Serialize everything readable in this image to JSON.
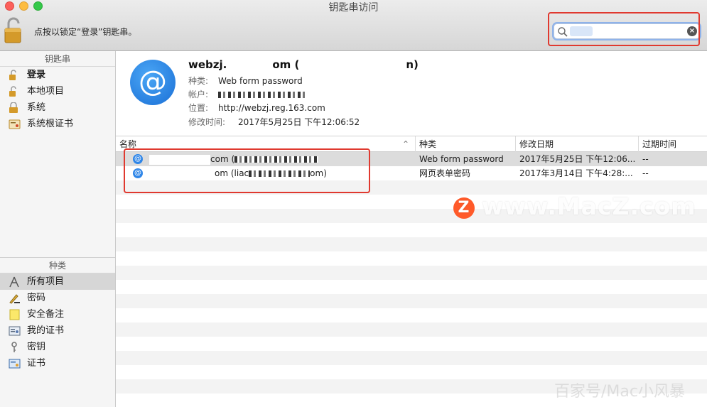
{
  "window": {
    "title": "钥匙串访问"
  },
  "toolbar": {
    "lock_hint": "点按以锁定“登录”钥匙串。"
  },
  "search": {
    "value": "",
    "placeholder": ""
  },
  "sidebar": {
    "keychains_header": "钥匙串",
    "keychains": [
      {
        "label": "登录",
        "icon": "lock-open-icon"
      },
      {
        "label": "本地项目",
        "icon": "lock-open-icon"
      },
      {
        "label": "系统",
        "icon": "lock-icon"
      },
      {
        "label": "系统根证书",
        "icon": "certificate-icon"
      }
    ],
    "kinds_header": "种类",
    "kinds": [
      {
        "label": "所有项目",
        "icon": "all-items-icon"
      },
      {
        "label": "密码",
        "icon": "password-icon"
      },
      {
        "label": "安全备注",
        "icon": "secure-note-icon"
      },
      {
        "label": "我的证书",
        "icon": "my-cert-icon"
      },
      {
        "label": "密钥",
        "icon": "key-icon"
      },
      {
        "label": "证书",
        "icon": "certificate-icon"
      }
    ]
  },
  "detail": {
    "title_prefix": "webzj.",
    "title_mid": "om (",
    "title_suffix": "n)",
    "kind_label": "种类:",
    "kind_value": "Web form password",
    "account_label": "帐户:",
    "where_label": "位置:",
    "where_value": "http://webzj.reg.163.com",
    "modified_label": "修改时间:",
    "modified_value": "2017年5月25日 下午12:06:52"
  },
  "table": {
    "columns": [
      "名称",
      "种类",
      "修改日期",
      "过期时间"
    ],
    "rows": [
      {
        "name_suffix": "com (",
        "kind": "Web form password",
        "date": "2017年5月25日 下午12:06...",
        "expires": "--"
      },
      {
        "name_suffix": "om  (liac",
        "name_end": "om)",
        "kind": "网页表单密码",
        "date": "2017年3月14日 下午4:28:...",
        "expires": "--"
      }
    ]
  },
  "watermark": {
    "text": "www.MacZ.com",
    "logo": "Z",
    "bottom_text": "百家号/Mac小风暴"
  }
}
